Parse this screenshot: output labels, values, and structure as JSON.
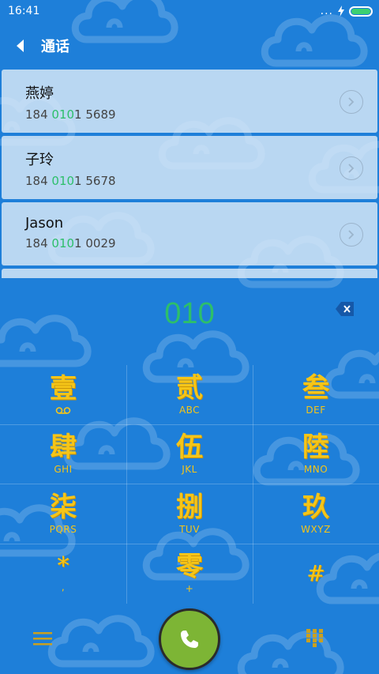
{
  "status_bar": {
    "time": "16:41",
    "dots": "..."
  },
  "header": {
    "title": "通话"
  },
  "contacts": [
    {
      "name": "燕婷",
      "number_prefix": "184 ",
      "number_match": "010",
      "number_suffix": "1 5689"
    },
    {
      "name": "子玲",
      "number_prefix": "184 ",
      "number_match": "010",
      "number_suffix": "1 5678"
    },
    {
      "name": "Jason",
      "number_prefix": "184 ",
      "number_match": "010",
      "number_suffix": "1 0029"
    }
  ],
  "dial": {
    "input": "010"
  },
  "keypad": [
    {
      "glyph": "壹",
      "sub": ""
    },
    {
      "glyph": "贰",
      "sub": "ABC"
    },
    {
      "glyph": "叁",
      "sub": "DEF"
    },
    {
      "glyph": "肆",
      "sub": "GHI"
    },
    {
      "glyph": "伍",
      "sub": "JKL"
    },
    {
      "glyph": "陸",
      "sub": "MNO"
    },
    {
      "glyph": "柒",
      "sub": "PQRS"
    },
    {
      "glyph": "捌",
      "sub": "TUV"
    },
    {
      "glyph": "玖",
      "sub": "WXYZ"
    },
    {
      "glyph": "*",
      "sub": ","
    },
    {
      "glyph": "零",
      "sub": "+"
    },
    {
      "glyph": "#",
      "sub": ""
    }
  ],
  "colors": {
    "background": "#1E7FD9",
    "key_gold": "#F5C518",
    "match_green": "#2DBF6A",
    "call_green": "#7DB535",
    "battery_green": "#3CD070"
  },
  "icons": {
    "back": "back-arrow-icon",
    "detail": "chevron-right-icon",
    "backspace": "backspace-icon",
    "voicemail": "voicemail-icon",
    "menu": "menu-icon",
    "call": "phone-icon",
    "keypad": "dialpad-icon",
    "charging": "lightning-icon",
    "battery": "battery-icon"
  }
}
